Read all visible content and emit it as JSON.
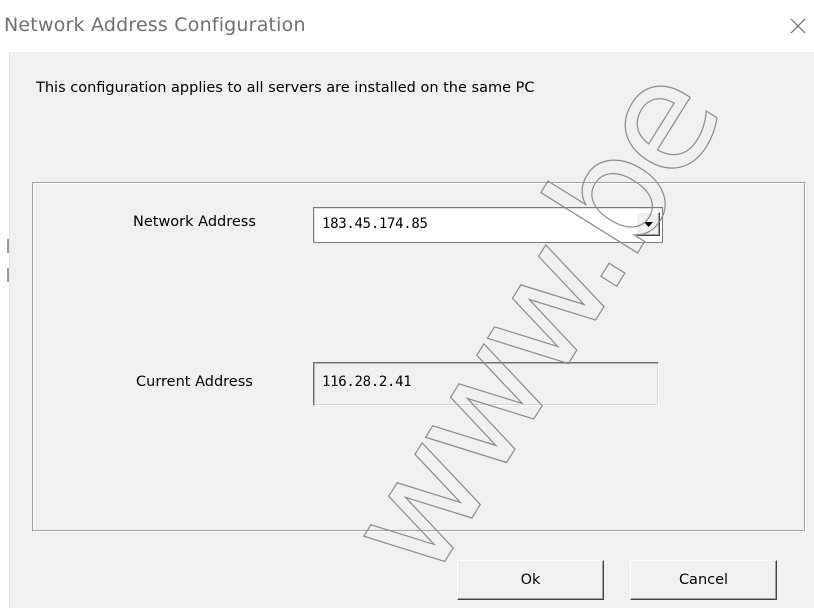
{
  "window": {
    "title": "Network Address Configuration"
  },
  "info": {
    "text": "This configuration applies to all servers are installed on the same PC"
  },
  "network_address": {
    "label": "Network Address",
    "selected_value": "183.45.174.85"
  },
  "current_address": {
    "label": "Current Address",
    "value": "116.28.2.41"
  },
  "buttons": {
    "ok_label": "Ok",
    "cancel_label": "Cancel"
  },
  "watermark": {
    "text": "www.be"
  },
  "colors": {
    "dialog_background": "#f0f0f0",
    "title_text": "#707070",
    "watermark": "#8a8a8a"
  },
  "icons": {
    "close": "close-icon",
    "dropdown": "chevron-down-icon"
  }
}
